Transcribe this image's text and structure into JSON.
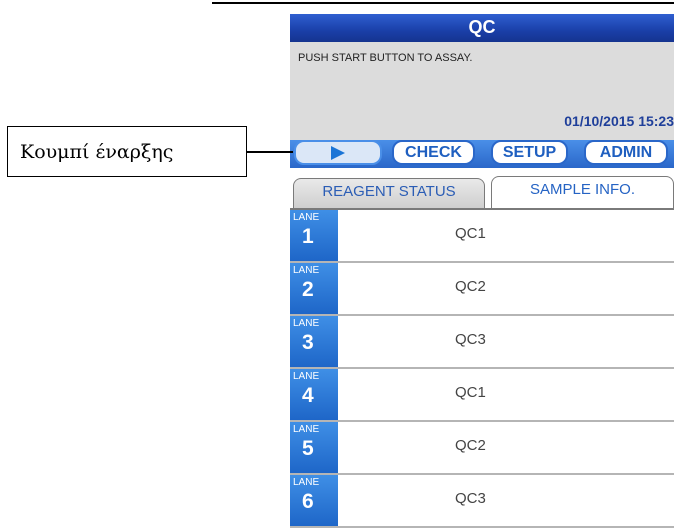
{
  "window": {
    "title": "QC"
  },
  "message": {
    "text": "PUSH START BUTTON TO ASSAY.",
    "datetime": "01/10/2015 15:23"
  },
  "toolbar": {
    "start_icon": "play-icon",
    "check_label": "CHECK",
    "setup_label": "SETUP",
    "admin_label": "ADMIN"
  },
  "tabs": [
    {
      "label": "REAGENT STATUS",
      "selected": false
    },
    {
      "label": "SAMPLE INFO.",
      "selected": true
    }
  ],
  "lanes": [
    {
      "word": "LANE",
      "number": "1",
      "sample": "QC1"
    },
    {
      "word": "LANE",
      "number": "2",
      "sample": "QC2"
    },
    {
      "word": "LANE",
      "number": "3",
      "sample": "QC3"
    },
    {
      "word": "LANE",
      "number": "4",
      "sample": "QC1"
    },
    {
      "word": "LANE",
      "number": "5",
      "sample": "QC2"
    },
    {
      "word": "LANE",
      "number": "6",
      "sample": "QC3"
    }
  ],
  "annotation": {
    "label": "Κουμπί έναρξης"
  },
  "colors": {
    "title_bar": "#1a3fa8",
    "toolbar": "#2a67c9",
    "lane_tag": "#1e66c8",
    "message_area": "#dcdcdc"
  }
}
